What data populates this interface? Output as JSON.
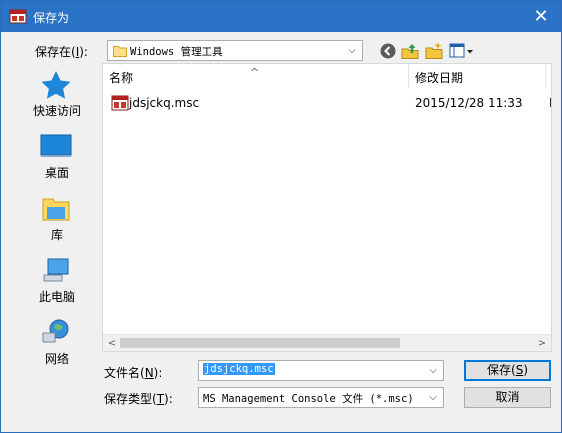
{
  "window": {
    "title": "保存为",
    "close_glyph": "✕"
  },
  "save_in": {
    "label": "保存在(",
    "hotkey": "I",
    "label_end": "):",
    "value": "Windows 管理工具"
  },
  "toolbar": {
    "icons": [
      "back-icon",
      "up-folder-icon",
      "new-folder-icon",
      "view-menu-icon"
    ]
  },
  "places": [
    {
      "label": "快速访问",
      "icon": "quick-access-icon"
    },
    {
      "label": "桌面",
      "icon": "desktop-icon"
    },
    {
      "label": "库",
      "icon": "libraries-icon"
    },
    {
      "label": "此电脑",
      "icon": "this-pc-icon"
    },
    {
      "label": "网络",
      "icon": "network-icon"
    }
  ],
  "columns": {
    "name": "名称",
    "modified": "修改日期",
    "extra": ""
  },
  "files": [
    {
      "name": "jdsjckq.msc",
      "modified": "2015/12/28 11:33",
      "extra": "M"
    }
  ],
  "filename": {
    "label": "文件名(",
    "hotkey": "N",
    "label_end": "):",
    "value": "jdsjckq.msc"
  },
  "filetype": {
    "label": "保存类型(",
    "hotkey": "T",
    "label_end": "):",
    "value": "MS Management Console 文件 (*.msc)"
  },
  "buttons": {
    "save": "保存(",
    "save_hotkey": "S",
    "save_end": ")",
    "cancel": "取消"
  },
  "colors": {
    "title_bar": "#2b73c7",
    "selection": "#3399ff",
    "accent": "#0078d7"
  }
}
